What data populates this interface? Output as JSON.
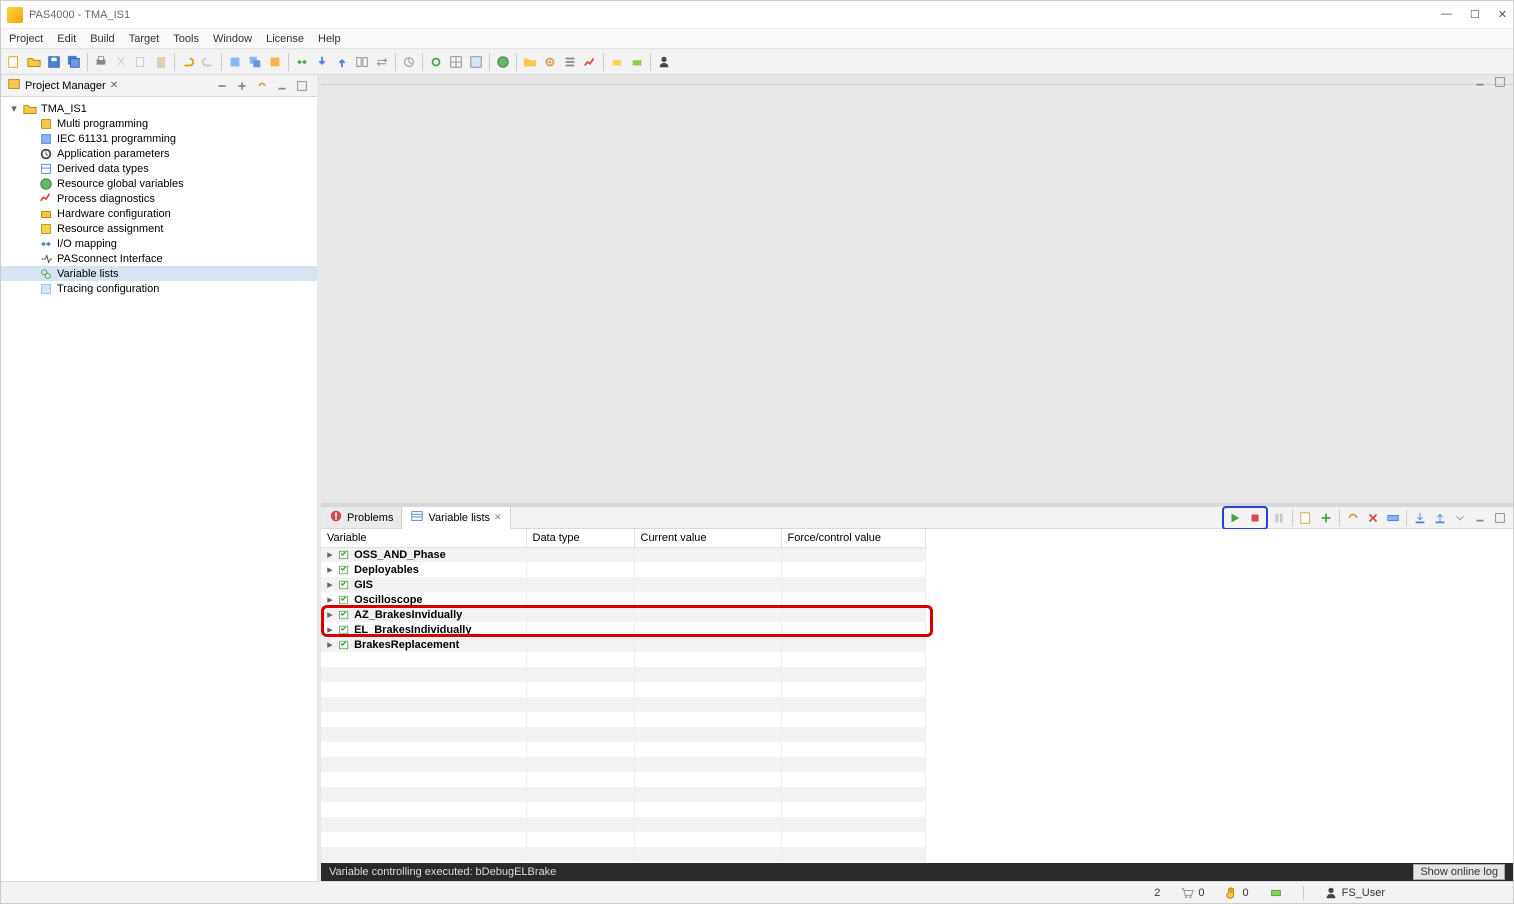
{
  "titlebar": {
    "title": "PAS4000 - TMA_IS1"
  },
  "menu": [
    "Project",
    "Edit",
    "Build",
    "Target",
    "Tools",
    "Window",
    "License",
    "Help"
  ],
  "project_manager": {
    "title": "Project Manager",
    "root": "TMA_IS1",
    "items": [
      "Multi programming",
      "IEC 61131 programming",
      "Application parameters",
      "Derived data types",
      "Resource global variables",
      "Process diagnostics",
      "Hardware configuration",
      "Resource assignment",
      "I/O mapping",
      "PASconnect Interface",
      "Variable lists",
      "Tracing configuration"
    ],
    "selected_index": 10
  },
  "bottom_tabs": {
    "tab1": "Problems",
    "tab2": "Variable lists"
  },
  "varlist_table": {
    "columns": [
      "Variable",
      "Data type",
      "Current value",
      "Force/control value"
    ],
    "rows": [
      "OSS_AND_Phase",
      "Deployables",
      "GIS",
      "Oscilloscope",
      "AZ_BrakesInvidually",
      "EL_BrakesIndividually",
      "BrakesReplacement"
    ]
  },
  "status_dark": {
    "message": "Variable controlling executed: bDebugELBrake",
    "button": "Show online log"
  },
  "statusbar": {
    "num": "2",
    "cart": "0",
    "hand": "0",
    "user": "FS_User"
  }
}
